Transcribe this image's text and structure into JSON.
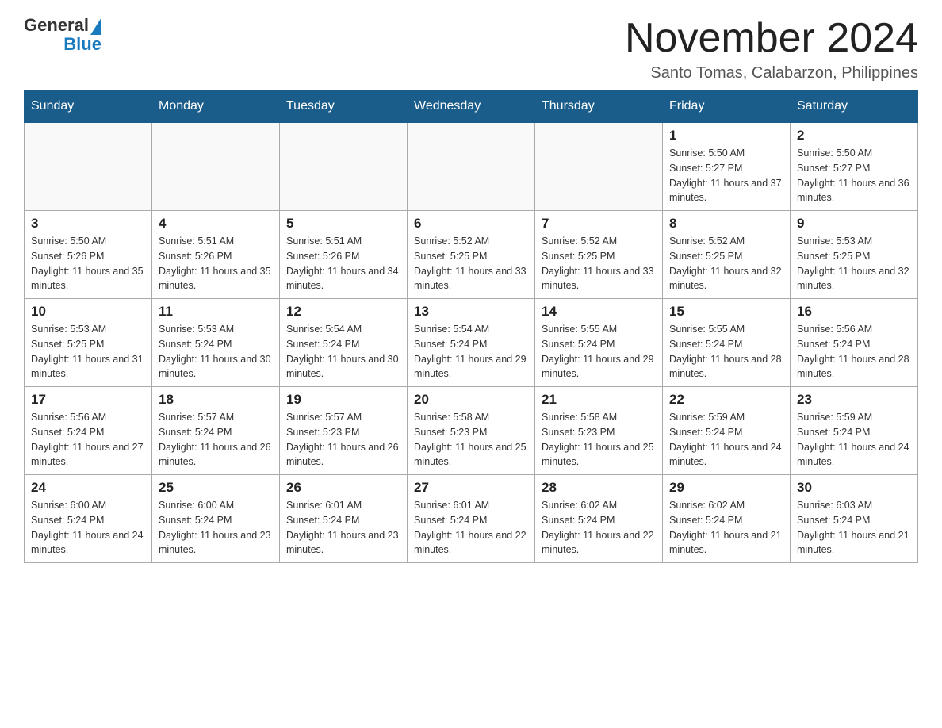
{
  "header": {
    "logo_text_general": "General",
    "logo_text_blue": "Blue",
    "month_title": "November 2024",
    "subtitle": "Santo Tomas, Calabarzon, Philippines"
  },
  "weekdays": [
    "Sunday",
    "Monday",
    "Tuesday",
    "Wednesday",
    "Thursday",
    "Friday",
    "Saturday"
  ],
  "weeks": [
    [
      {
        "day": "",
        "sunrise": "",
        "sunset": "",
        "daylight": ""
      },
      {
        "day": "",
        "sunrise": "",
        "sunset": "",
        "daylight": ""
      },
      {
        "day": "",
        "sunrise": "",
        "sunset": "",
        "daylight": ""
      },
      {
        "day": "",
        "sunrise": "",
        "sunset": "",
        "daylight": ""
      },
      {
        "day": "",
        "sunrise": "",
        "sunset": "",
        "daylight": ""
      },
      {
        "day": "1",
        "sunrise": "Sunrise: 5:50 AM",
        "sunset": "Sunset: 5:27 PM",
        "daylight": "Daylight: 11 hours and 37 minutes."
      },
      {
        "day": "2",
        "sunrise": "Sunrise: 5:50 AM",
        "sunset": "Sunset: 5:27 PM",
        "daylight": "Daylight: 11 hours and 36 minutes."
      }
    ],
    [
      {
        "day": "3",
        "sunrise": "Sunrise: 5:50 AM",
        "sunset": "Sunset: 5:26 PM",
        "daylight": "Daylight: 11 hours and 35 minutes."
      },
      {
        "day": "4",
        "sunrise": "Sunrise: 5:51 AM",
        "sunset": "Sunset: 5:26 PM",
        "daylight": "Daylight: 11 hours and 35 minutes."
      },
      {
        "day": "5",
        "sunrise": "Sunrise: 5:51 AM",
        "sunset": "Sunset: 5:26 PM",
        "daylight": "Daylight: 11 hours and 34 minutes."
      },
      {
        "day": "6",
        "sunrise": "Sunrise: 5:52 AM",
        "sunset": "Sunset: 5:25 PM",
        "daylight": "Daylight: 11 hours and 33 minutes."
      },
      {
        "day": "7",
        "sunrise": "Sunrise: 5:52 AM",
        "sunset": "Sunset: 5:25 PM",
        "daylight": "Daylight: 11 hours and 33 minutes."
      },
      {
        "day": "8",
        "sunrise": "Sunrise: 5:52 AM",
        "sunset": "Sunset: 5:25 PM",
        "daylight": "Daylight: 11 hours and 32 minutes."
      },
      {
        "day": "9",
        "sunrise": "Sunrise: 5:53 AM",
        "sunset": "Sunset: 5:25 PM",
        "daylight": "Daylight: 11 hours and 32 minutes."
      }
    ],
    [
      {
        "day": "10",
        "sunrise": "Sunrise: 5:53 AM",
        "sunset": "Sunset: 5:25 PM",
        "daylight": "Daylight: 11 hours and 31 minutes."
      },
      {
        "day": "11",
        "sunrise": "Sunrise: 5:53 AM",
        "sunset": "Sunset: 5:24 PM",
        "daylight": "Daylight: 11 hours and 30 minutes."
      },
      {
        "day": "12",
        "sunrise": "Sunrise: 5:54 AM",
        "sunset": "Sunset: 5:24 PM",
        "daylight": "Daylight: 11 hours and 30 minutes."
      },
      {
        "day": "13",
        "sunrise": "Sunrise: 5:54 AM",
        "sunset": "Sunset: 5:24 PM",
        "daylight": "Daylight: 11 hours and 29 minutes."
      },
      {
        "day": "14",
        "sunrise": "Sunrise: 5:55 AM",
        "sunset": "Sunset: 5:24 PM",
        "daylight": "Daylight: 11 hours and 29 minutes."
      },
      {
        "day": "15",
        "sunrise": "Sunrise: 5:55 AM",
        "sunset": "Sunset: 5:24 PM",
        "daylight": "Daylight: 11 hours and 28 minutes."
      },
      {
        "day": "16",
        "sunrise": "Sunrise: 5:56 AM",
        "sunset": "Sunset: 5:24 PM",
        "daylight": "Daylight: 11 hours and 28 minutes."
      }
    ],
    [
      {
        "day": "17",
        "sunrise": "Sunrise: 5:56 AM",
        "sunset": "Sunset: 5:24 PM",
        "daylight": "Daylight: 11 hours and 27 minutes."
      },
      {
        "day": "18",
        "sunrise": "Sunrise: 5:57 AM",
        "sunset": "Sunset: 5:24 PM",
        "daylight": "Daylight: 11 hours and 26 minutes."
      },
      {
        "day": "19",
        "sunrise": "Sunrise: 5:57 AM",
        "sunset": "Sunset: 5:23 PM",
        "daylight": "Daylight: 11 hours and 26 minutes."
      },
      {
        "day": "20",
        "sunrise": "Sunrise: 5:58 AM",
        "sunset": "Sunset: 5:23 PM",
        "daylight": "Daylight: 11 hours and 25 minutes."
      },
      {
        "day": "21",
        "sunrise": "Sunrise: 5:58 AM",
        "sunset": "Sunset: 5:23 PM",
        "daylight": "Daylight: 11 hours and 25 minutes."
      },
      {
        "day": "22",
        "sunrise": "Sunrise: 5:59 AM",
        "sunset": "Sunset: 5:24 PM",
        "daylight": "Daylight: 11 hours and 24 minutes."
      },
      {
        "day": "23",
        "sunrise": "Sunrise: 5:59 AM",
        "sunset": "Sunset: 5:24 PM",
        "daylight": "Daylight: 11 hours and 24 minutes."
      }
    ],
    [
      {
        "day": "24",
        "sunrise": "Sunrise: 6:00 AM",
        "sunset": "Sunset: 5:24 PM",
        "daylight": "Daylight: 11 hours and 24 minutes."
      },
      {
        "day": "25",
        "sunrise": "Sunrise: 6:00 AM",
        "sunset": "Sunset: 5:24 PM",
        "daylight": "Daylight: 11 hours and 23 minutes."
      },
      {
        "day": "26",
        "sunrise": "Sunrise: 6:01 AM",
        "sunset": "Sunset: 5:24 PM",
        "daylight": "Daylight: 11 hours and 23 minutes."
      },
      {
        "day": "27",
        "sunrise": "Sunrise: 6:01 AM",
        "sunset": "Sunset: 5:24 PM",
        "daylight": "Daylight: 11 hours and 22 minutes."
      },
      {
        "day": "28",
        "sunrise": "Sunrise: 6:02 AM",
        "sunset": "Sunset: 5:24 PM",
        "daylight": "Daylight: 11 hours and 22 minutes."
      },
      {
        "day": "29",
        "sunrise": "Sunrise: 6:02 AM",
        "sunset": "Sunset: 5:24 PM",
        "daylight": "Daylight: 11 hours and 21 minutes."
      },
      {
        "day": "30",
        "sunrise": "Sunrise: 6:03 AM",
        "sunset": "Sunset: 5:24 PM",
        "daylight": "Daylight: 11 hours and 21 minutes."
      }
    ]
  ]
}
